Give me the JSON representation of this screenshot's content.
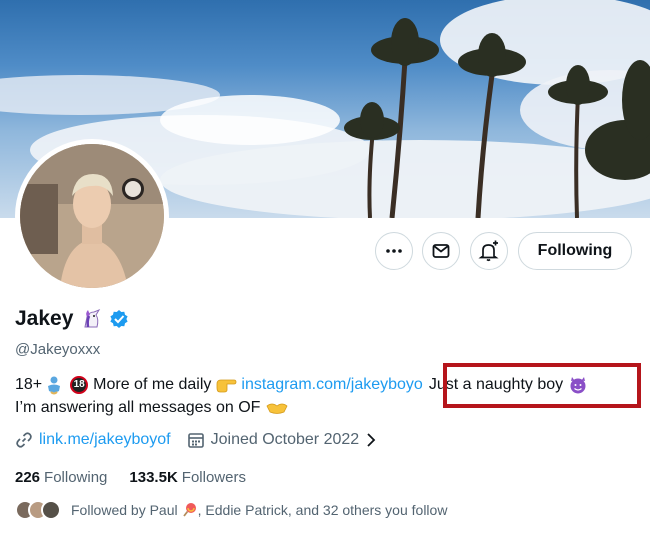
{
  "profile": {
    "name": "Jakey",
    "handle": "@Jakeyoxxx",
    "bio_line1_start": "18+",
    "bio_badge": "18",
    "bio_line1_mid": "More of me daily",
    "bio_link": "instagram.com/jakeyboyo",
    "bio_highlight": "Just a naughty boy",
    "bio_line2": "I’m answering all messages on OF",
    "website": "link.me/jakeyboyof",
    "joined": "Joined October 2022"
  },
  "actions": {
    "follow_label": "Following"
  },
  "stats": {
    "following_count": "226",
    "following_label": "Following",
    "followers_count": "133.5K",
    "followers_label": "Followers"
  },
  "followed_by": {
    "text_prefix": "Followed by Paul",
    "text_suffix": ", Eddie Patrick, and 32 others you follow"
  },
  "colors": {
    "link": "#1d9bf0",
    "verified": "#1d9bf0",
    "highlight_box": "#b5151b"
  },
  "icons": [
    "more-icon",
    "message-icon",
    "notify-icon",
    "unicorn-icon",
    "verified-icon",
    "link-icon",
    "calendar-icon",
    "chevron-right-icon"
  ]
}
